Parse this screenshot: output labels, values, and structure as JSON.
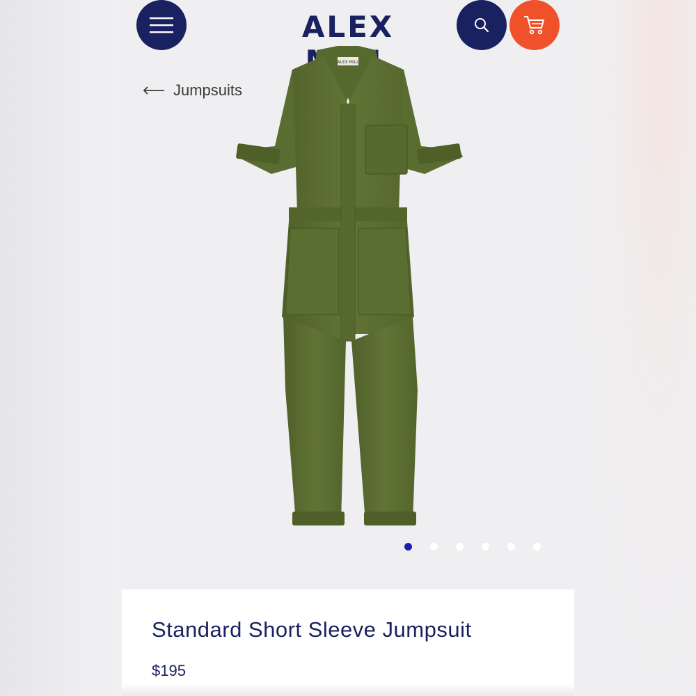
{
  "brand": {
    "name": "ALEX MILL"
  },
  "header": {
    "menu_icon": "hamburger-menu-icon",
    "search_icon": "search-icon",
    "cart_icon": "shopping-cart-icon",
    "colors": {
      "navy": "#1a2160",
      "cart_orange": "#f0502a"
    }
  },
  "breadcrumb": {
    "label": "Jumpsuits",
    "icon": "left-arrow-icon"
  },
  "product": {
    "image_label": "ALEX MILL",
    "title": "Standard Short Sleeve Jumpsuit",
    "price": "$195",
    "garment_color": "#5c6e33"
  },
  "carousel": {
    "total": 6,
    "active": 1,
    "active_color": "#1a1fb0"
  }
}
